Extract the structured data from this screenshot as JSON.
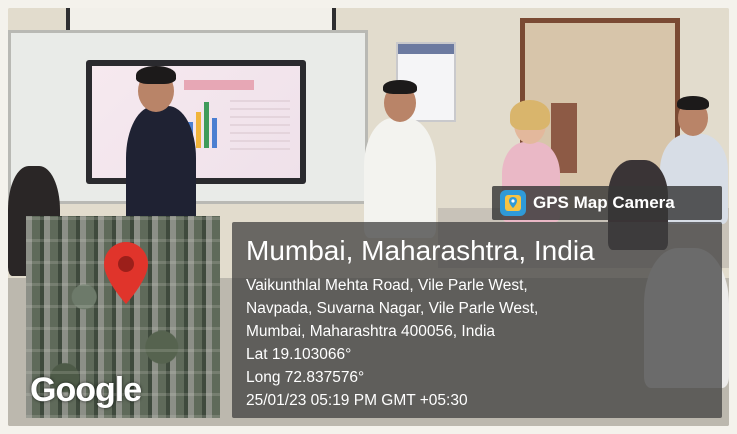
{
  "overlay": {
    "badge_label": "GPS Map Camera",
    "location_title": "Mumbai, Maharashtra, India",
    "address_lines": [
      "Vaikunthlal Mehta Road, Vile Parle West,",
      "Navpada, Suvarna Nagar, Vile Parle West,",
      "Mumbai, Maharashtra 400056, India"
    ],
    "latitude": "Lat 19.103066°",
    "longitude": "Long 72.837576°",
    "datetime": "25/01/23 05:19 PM GMT +05:30"
  },
  "map": {
    "logo": "Google",
    "pin_icon": "map-pin-icon",
    "pin_color": "#e0342b"
  },
  "colors": {
    "panel_bg": "#3e3e3e",
    "app_icon": "#2f9ad8"
  }
}
